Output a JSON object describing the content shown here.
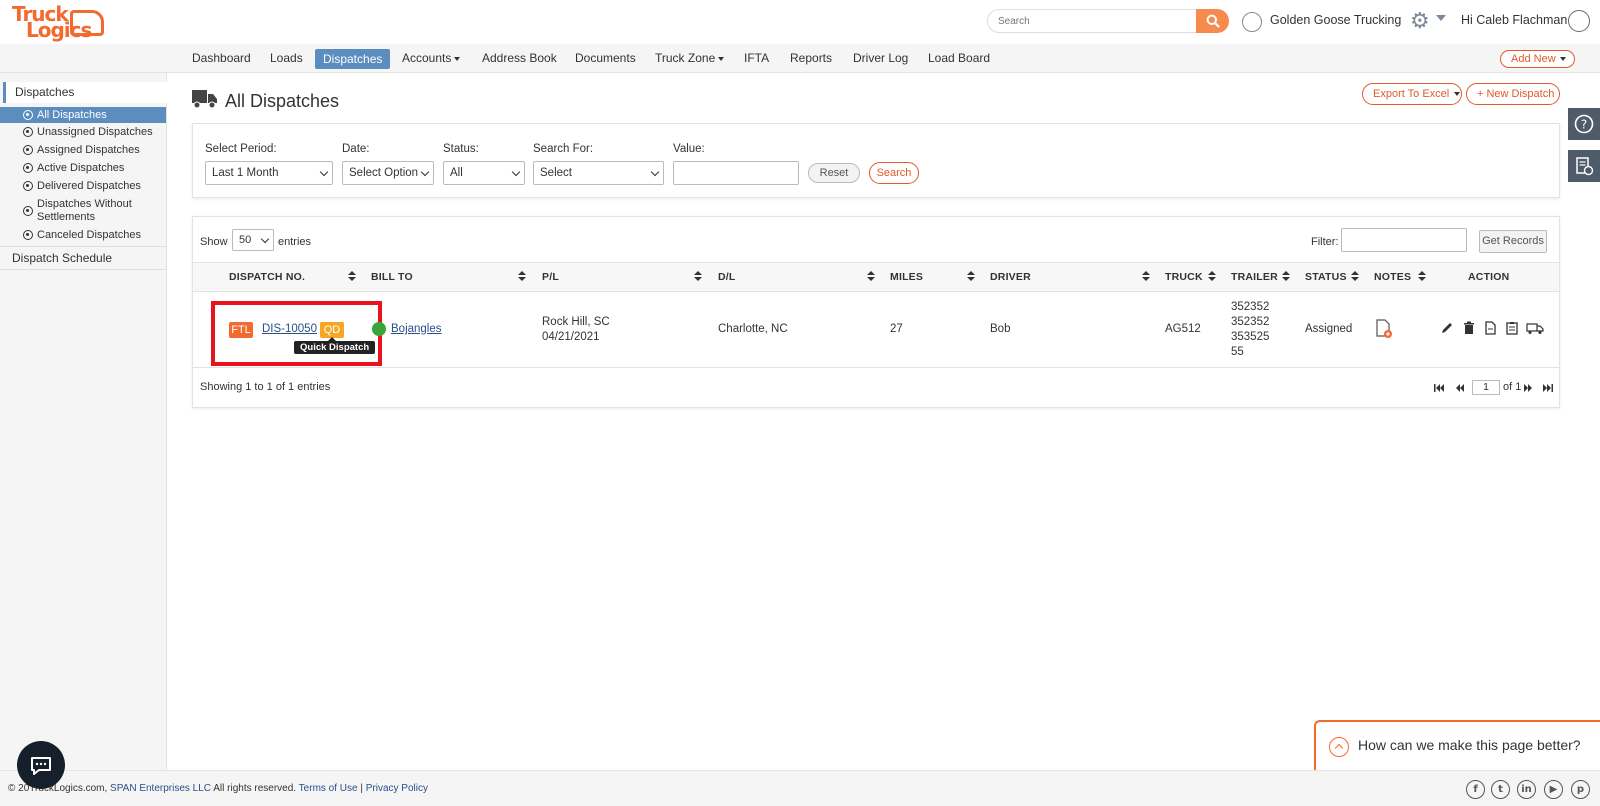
{
  "brand": {
    "line1": "Truck",
    "line2": "Logics",
    "accent": "#f26a2e"
  },
  "header": {
    "search_placeholder": "Search",
    "company": "Golden Goose Trucking",
    "greeting": "Hi Caleb Flachman"
  },
  "nav": {
    "items": [
      "Dashboard",
      "Loads",
      "Dispatches",
      "Accounts",
      "Address Book",
      "Documents",
      "Truck Zone",
      "IFTA",
      "Reports",
      "Driver Log",
      "Load Board"
    ],
    "active": "Dispatches",
    "add_new": "Add New"
  },
  "sidebar": {
    "section": "Dispatches",
    "items": [
      "All Dispatches",
      "Unassigned Dispatches",
      "Assigned Dispatches",
      "Active Dispatches",
      "Delivered Dispatches",
      "Dispatches Without Settlements",
      "Canceled Dispatches"
    ],
    "schedule": "Dispatch Schedule"
  },
  "page": {
    "title": "All Dispatches",
    "export_label": "Export To Excel",
    "new_label": "+ New Dispatch"
  },
  "filters": {
    "period_label": "Select Period:",
    "period_value": "Last 1 Month",
    "date_label": "Date:",
    "date_value": "Select Option",
    "status_label": "Status:",
    "status_value": "All",
    "search_for_label": "Search For:",
    "search_for_value": "Select",
    "value_label": "Value:",
    "value_value": "",
    "reset": "Reset",
    "search": "Search"
  },
  "table": {
    "show_label": "Show",
    "show_value": "50",
    "entries_label": "entries",
    "filter_label": "Filter:",
    "get_records": "Get Records",
    "columns": [
      "DISPATCH NO.",
      "BILL TO",
      "P/L",
      "D/L",
      "MILES",
      "DRIVER",
      "TRUCK",
      "TRAILER",
      "STATUS",
      "NOTES",
      "ACTION"
    ],
    "rows": [
      {
        "type_badge": "FTL",
        "dispatch_no": "DIS-10050",
        "qd_badge": "QD",
        "tooltip": "Quick Dispatch",
        "bill_to": "Bojangles",
        "pl_city": "Rock Hill, SC",
        "pl_date": "04/21/2021",
        "dl": "Charlotte, NC",
        "miles": "27",
        "driver": "Bob",
        "truck": "AG512",
        "trailer_lines": [
          "352352",
          "352352",
          "353525",
          "55"
        ],
        "status": "Assigned"
      }
    ],
    "showing": "Showing 1 to 1 of 1 entries",
    "page_current": "1",
    "page_of": "of 1"
  },
  "footer": {
    "copyright_prefix": "© 20",
    "copyright_mid": "TruckLogics.com,",
    "company_link": "SPAN Enterprises LLC",
    "rights": "All rights reserved.",
    "terms": "Terms of Use",
    "separator": "|",
    "privacy": "Privacy Policy"
  },
  "feedback": {
    "text": "How can we make this page better?"
  },
  "social_icons": [
    "facebook-icon",
    "twitter-icon",
    "linkedin-icon",
    "youtube-icon",
    "pinterest-icon"
  ]
}
